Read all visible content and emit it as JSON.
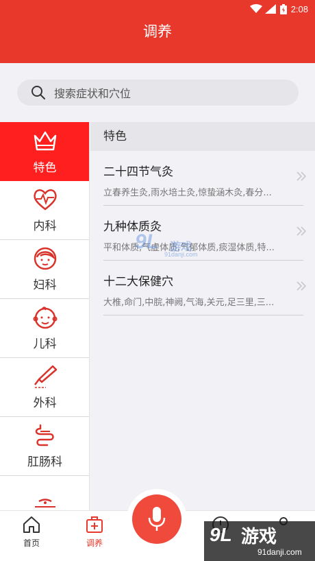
{
  "status_bar": {
    "time": "2:08"
  },
  "header": {
    "title": "调养"
  },
  "search": {
    "placeholder": "搜索症状和穴位"
  },
  "sidebar": {
    "items": [
      {
        "label": "特色",
        "icon": "crown-icon",
        "active": true
      },
      {
        "label": "内科",
        "icon": "heart-pulse-icon",
        "active": false
      },
      {
        "label": "妇科",
        "icon": "woman-face-icon",
        "active": false
      },
      {
        "label": "儿科",
        "icon": "baby-face-icon",
        "active": false
      },
      {
        "label": "外科",
        "icon": "scalpel-icon",
        "active": false
      },
      {
        "label": "肛肠科",
        "icon": "intestine-icon",
        "active": false
      }
    ]
  },
  "content": {
    "section_title": "特色",
    "items": [
      {
        "name": "二十四节气灸",
        "desc": "立春养生灸,雨水培土灸,惊蛰涵木灸,春分..."
      },
      {
        "name": "九种体质灸",
        "desc": "平和体质,气虚体质,气郁体质,痰湿体质,特..."
      },
      {
        "name": "十二大保健穴",
        "desc": "大椎,命门,中脘,神阙,气海,关元,足三里,三..."
      }
    ]
  },
  "tabbar": {
    "tabs": [
      {
        "label": "首页",
        "icon": "home-icon",
        "active": false
      },
      {
        "label": "调养",
        "icon": "medical-kit-icon",
        "active": true
      }
    ],
    "mic_icon": "microphone-icon"
  },
  "watermark": {
    "center_logo": "9L",
    "center_text": "游戏",
    "center_url": "91danji.com",
    "corner_logo": "9L",
    "corner_text": "游戏",
    "corner_url": "91danji.com"
  },
  "colors": {
    "primary": "#e8372b",
    "active_sidebar": "#ff1f1f"
  }
}
